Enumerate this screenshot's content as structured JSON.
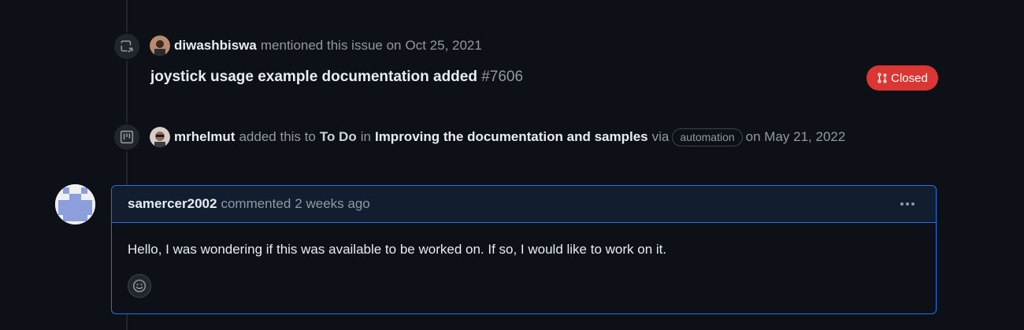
{
  "events": [
    {
      "icon": "cross-reference-icon",
      "author": "diwashbiswa",
      "action": "mentioned this issue on",
      "date": "Oct 25, 2021",
      "reference": {
        "title": "joystick usage example documentation added",
        "number": "#7606",
        "state": "Closed",
        "state_color": "#da3633"
      }
    },
    {
      "icon": "project-icon",
      "author": "mrhelmut",
      "action": "added this to",
      "column": "To Do",
      "in_word": "in",
      "project": "Improving the documentation and samples",
      "via_word": "via",
      "label": "automation",
      "on_text": "on May 21, 2022"
    }
  ],
  "comment": {
    "author": "samercer2002",
    "action": "commented",
    "time": "2 weeks ago",
    "body": "Hello, I was wondering if this was available to be worked on. If so, I would like to work on it.",
    "accent_color": "#1f6feb"
  }
}
